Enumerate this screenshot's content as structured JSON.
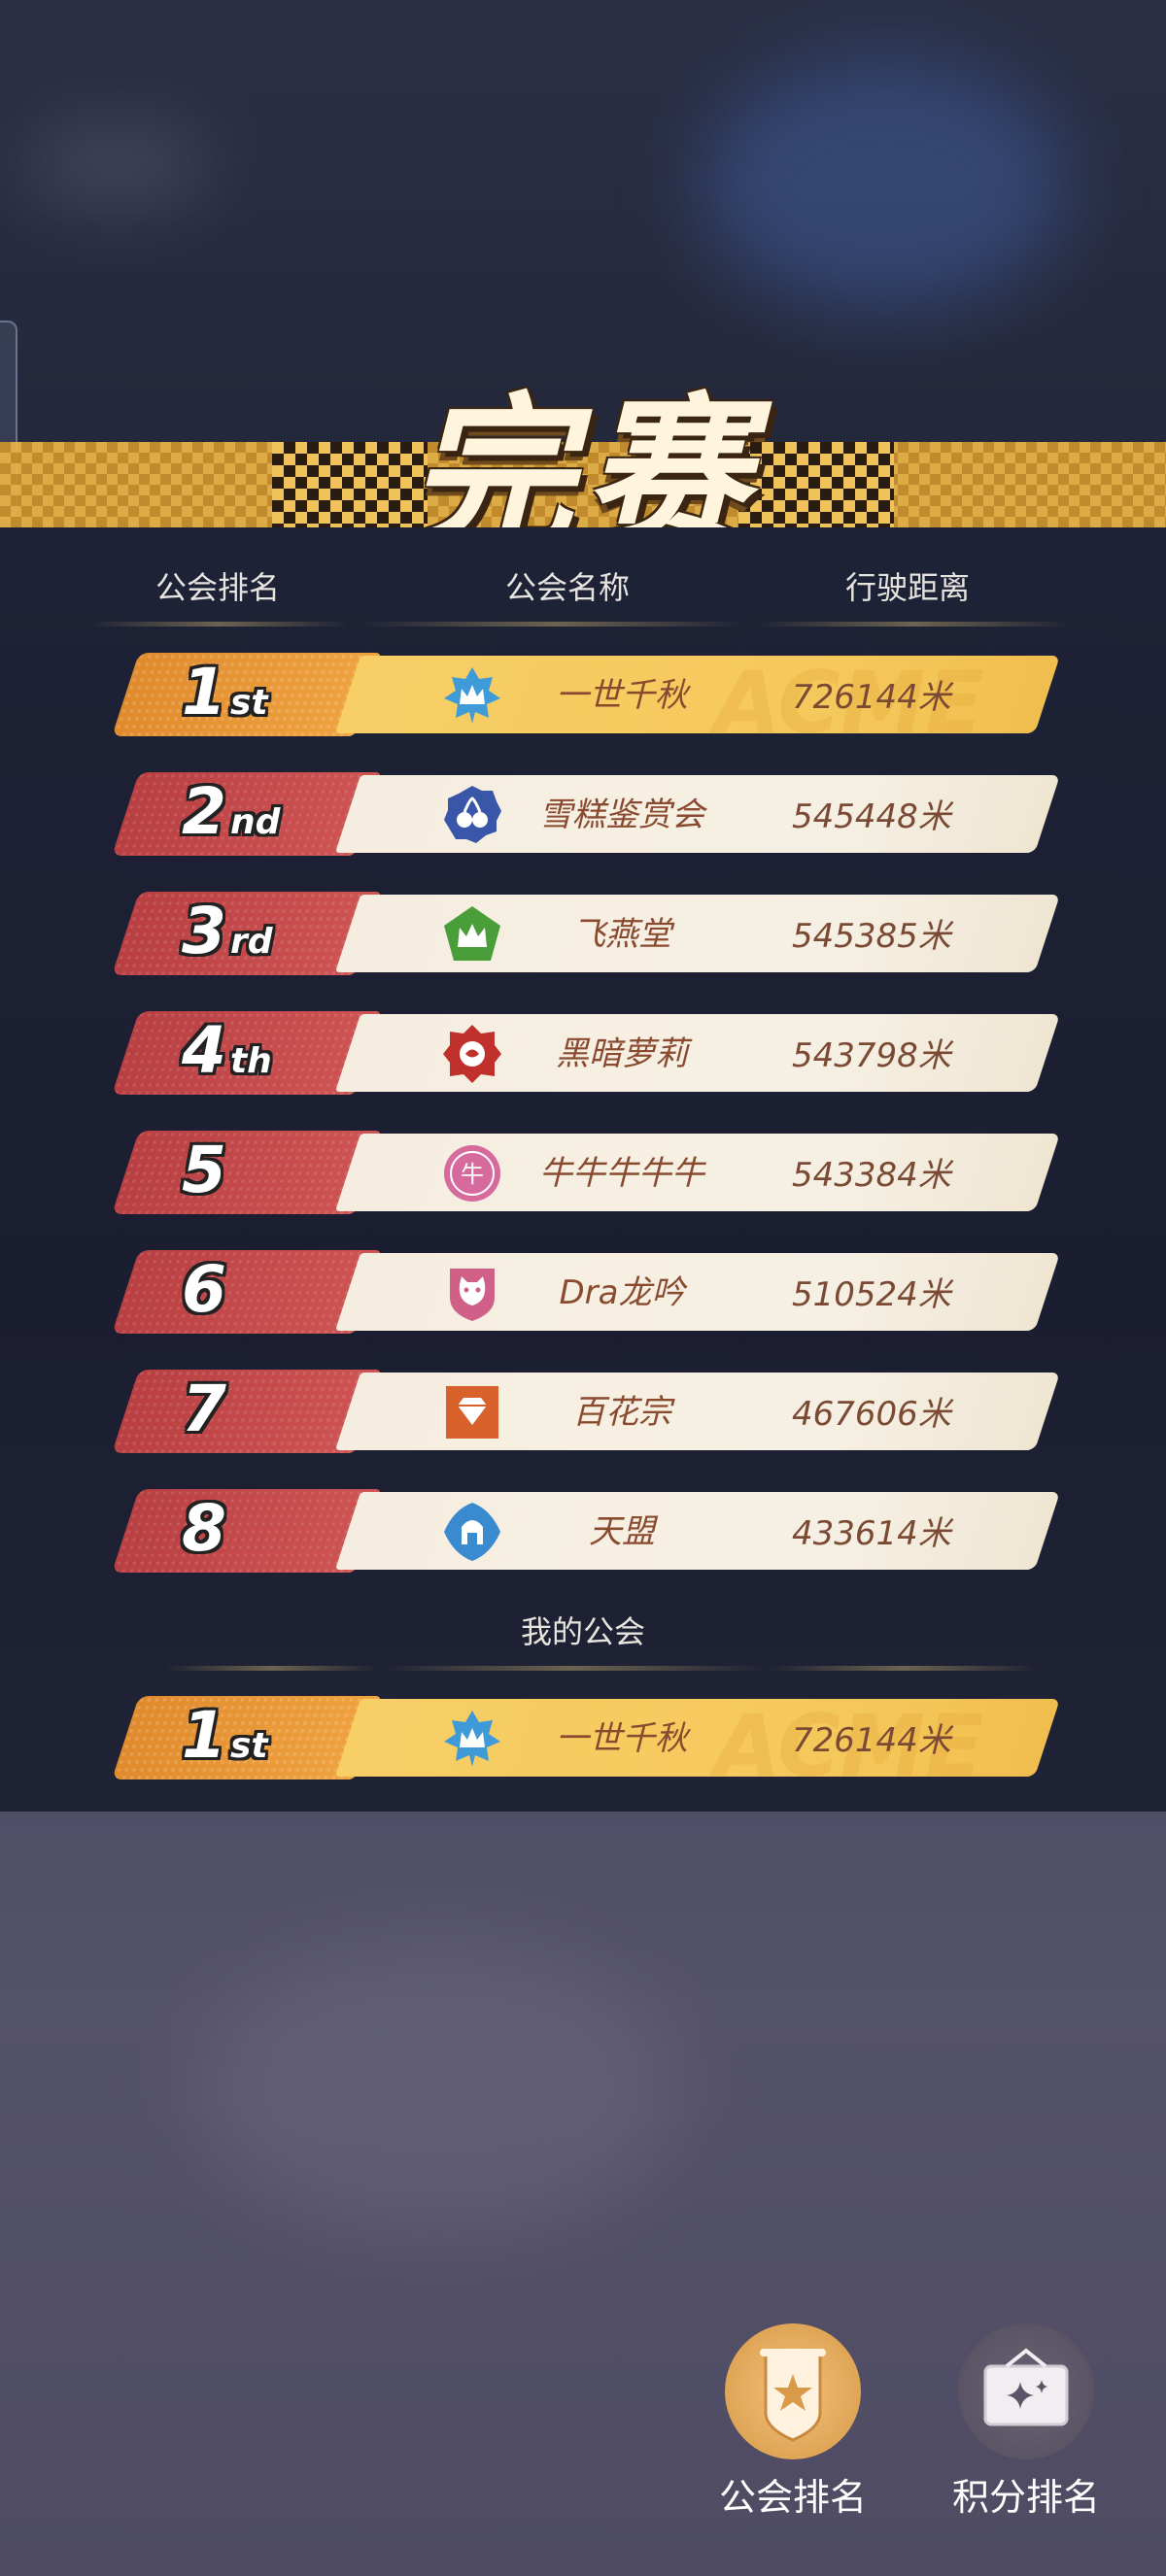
{
  "title": "完赛",
  "columns": {
    "rank": "公会排名",
    "name": "公会名称",
    "distance": "行驶距离"
  },
  "watermark": "ACME",
  "rankings": [
    {
      "rank_num": "1",
      "rank_suffix": "st",
      "name": "一世千秋",
      "distance": "726144米",
      "emblem": "crown-star-icon",
      "color": "#3f9ad8"
    },
    {
      "rank_num": "2",
      "rank_suffix": "nd",
      "name": "雪糕鉴赏会",
      "distance": "545448米",
      "emblem": "cherry-badge-icon",
      "color": "#3a56a8"
    },
    {
      "rank_num": "3",
      "rank_suffix": "rd",
      "name": "飞燕堂",
      "distance": "545385米",
      "emblem": "crown-pentagon-icon",
      "color": "#4a9e3a"
    },
    {
      "rank_num": "4",
      "rank_suffix": "th",
      "name": "黑暗萝莉",
      "distance": "543798米",
      "emblem": "rose-badge-icon",
      "color": "#c0302c"
    },
    {
      "rank_num": "5",
      "rank_suffix": "",
      "name": "牛牛牛牛牛",
      "distance": "543384米",
      "emblem": "niu-coin-icon",
      "color": "#d76a9c"
    },
    {
      "rank_num": "6",
      "rank_suffix": "",
      "name": "Dra龙吟",
      "distance": "510524米",
      "emblem": "cat-shield-icon",
      "color": "#d06088"
    },
    {
      "rank_num": "7",
      "rank_suffix": "",
      "name": "百花宗",
      "distance": "467606米",
      "emblem": "diamond-square-icon",
      "color": "#d8612c"
    },
    {
      "rank_num": "8",
      "rank_suffix": "",
      "name": "天盟",
      "distance": "433614米",
      "emblem": "helmet-badge-icon",
      "color": "#3a8ad0"
    }
  ],
  "my_guild_label": "我的公会",
  "my_guild": {
    "rank_num": "1",
    "rank_suffix": "st",
    "name": "一世千秋",
    "distance": "726144米",
    "emblem": "crown-star-icon"
  },
  "bottom_buttons": [
    {
      "label": "公会排名",
      "icon": "guild-banner-icon",
      "active": true
    },
    {
      "label": "积分排名",
      "icon": "sparkle-board-icon",
      "active": false
    }
  ],
  "colors": {
    "gold": "#f5c85c",
    "red_rank": "#c8484a",
    "panel": "#1c1f30"
  }
}
